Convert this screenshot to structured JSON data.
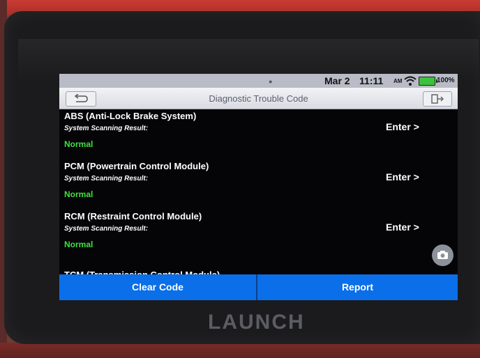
{
  "status_bar": {
    "date": "Mar 2",
    "time": "11:11",
    "ampm": "AM",
    "battery": "100%"
  },
  "header": {
    "title": "Diagnostic Trouble Code"
  },
  "systems": [
    {
      "name": "ABS (Anti-Lock Brake System)",
      "scan_label": "System Scanning Result:",
      "result": "Normal",
      "action": "Enter >"
    },
    {
      "name": "PCM (Powertrain Control Module)",
      "scan_label": "System Scanning Result:",
      "result": "Normal",
      "action": "Enter >"
    },
    {
      "name": "RCM (Restraint Control Module)",
      "scan_label": "System Scanning Result:",
      "result": "Normal",
      "action": "Enter >"
    }
  ],
  "partial_item": "TCM (Transmission Control Module)",
  "buttons": {
    "clear": "Clear Code",
    "report": "Report"
  },
  "brand": "LAUNCH",
  "colors": {
    "accent": "#0a6fe8",
    "status_ok": "#3fe03f"
  }
}
